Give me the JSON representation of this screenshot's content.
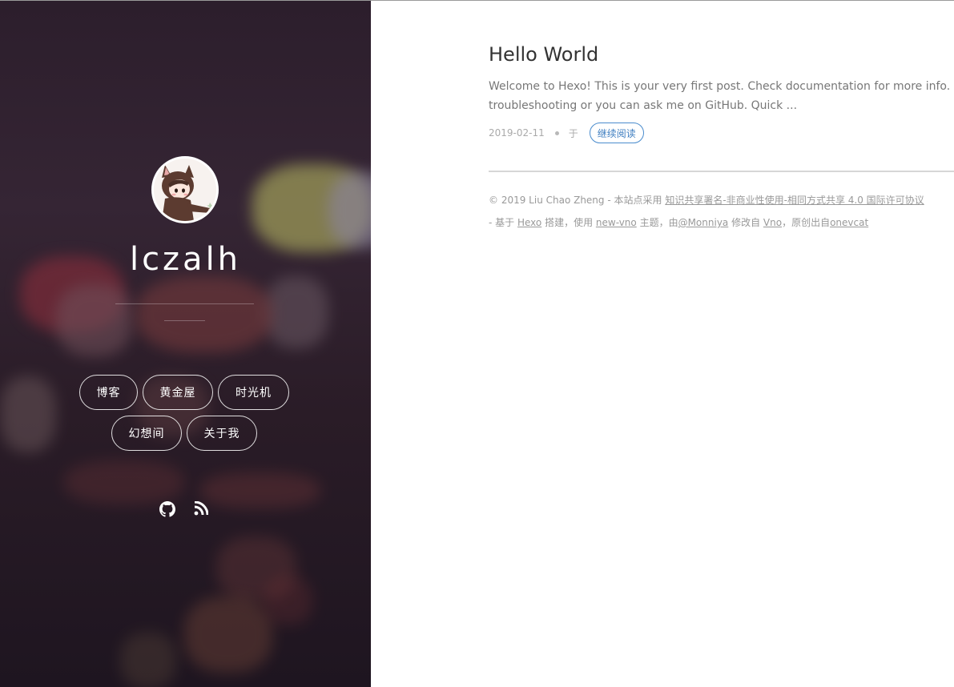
{
  "sidebar": {
    "site_title": "lczalh",
    "nav": [
      {
        "label": "博客"
      },
      {
        "label": "黄金屋"
      },
      {
        "label": "时光机"
      },
      {
        "label": "幻想间"
      },
      {
        "label": "关于我"
      }
    ],
    "social": [
      {
        "icon": "github-icon"
      },
      {
        "icon": "rss-icon"
      }
    ]
  },
  "post": {
    "title": "Hello World",
    "excerpt_line1": "Welcome to Hexo! This is your very first post. Check documentation for more info. If",
    "excerpt_line2": "troubleshooting or you can ask me on GitHub. Quick ...",
    "date": "2019-02-11",
    "yu": "于",
    "read_more": "继续阅读"
  },
  "footer": {
    "line1_prefix": "© 2019 Liu Chao Zheng - 本站点采用 ",
    "license_link": "知识共享署名-非商业性使用-相同方式共享 4.0 国际许可协议",
    "line2_prefix": "- 基于 ",
    "hexo_link": "Hexo",
    "line2_mid1": " 搭建，使用 ",
    "theme_link": "new-vno",
    "line2_mid2": " 主题，由",
    "monniya_link": "@Monniya",
    "line2_mid3": " 修改自 ",
    "vno_link": "Vno",
    "line2_mid4": "，原创出自",
    "onevcat_link": "onevcat"
  },
  "colors": {
    "read_more_accent": "#3d7dc0",
    "panel_bg": "#2c1e2c"
  }
}
